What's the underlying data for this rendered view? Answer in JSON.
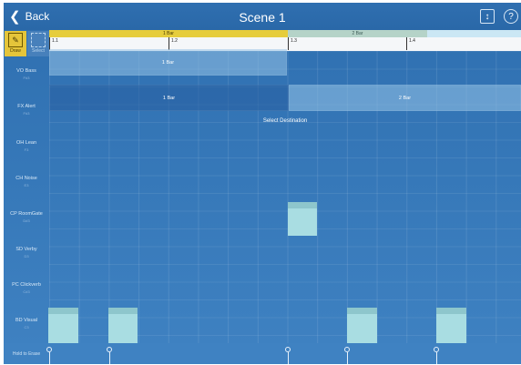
{
  "header": {
    "back_label": "Back",
    "title": "Scene 1",
    "expand_icon": "expand-vertical-icon",
    "help_icon": "help-icon"
  },
  "tools": {
    "draw_label": "Draw",
    "select_label": "Select"
  },
  "patterns": [
    {
      "label": "1 Bar",
      "color": "#e6cd3c"
    },
    {
      "label": "2 Bar",
      "color": "#b5d3c8"
    },
    {
      "label": "",
      "color": "#cbe7f4"
    }
  ],
  "ruler_ticks": [
    "1.1",
    "1.2",
    "1.3",
    "1.4"
  ],
  "ruler_ticks_secondary": [
    "1.2",
    "1.3"
  ],
  "lanes": [
    {
      "name": "VO Bass",
      "key": "F#3"
    },
    {
      "name": "FX Alert",
      "key": "F#3"
    },
    {
      "name": "OH Lean",
      "key": "F3"
    },
    {
      "name": "CH Noise",
      "key": "E3"
    },
    {
      "name": "CP RoomGate",
      "key": "D#3"
    },
    {
      "name": "SD Verby",
      "key": "D3"
    },
    {
      "name": "PC Clickverb",
      "key": "C#3"
    },
    {
      "name": "BD Visual",
      "key": "C3"
    }
  ],
  "regions": {
    "vo_bass": "1 Bar",
    "fx_alert_1": "1 Bar",
    "fx_alert_2": "2 Bar"
  },
  "select_destination": "Select Destination",
  "hold_to_erase": "Hold to Erase",
  "accent_colors": {
    "background": "#3a7abb",
    "draw_tool": "#e5c53a",
    "note": "#a9dde2"
  }
}
